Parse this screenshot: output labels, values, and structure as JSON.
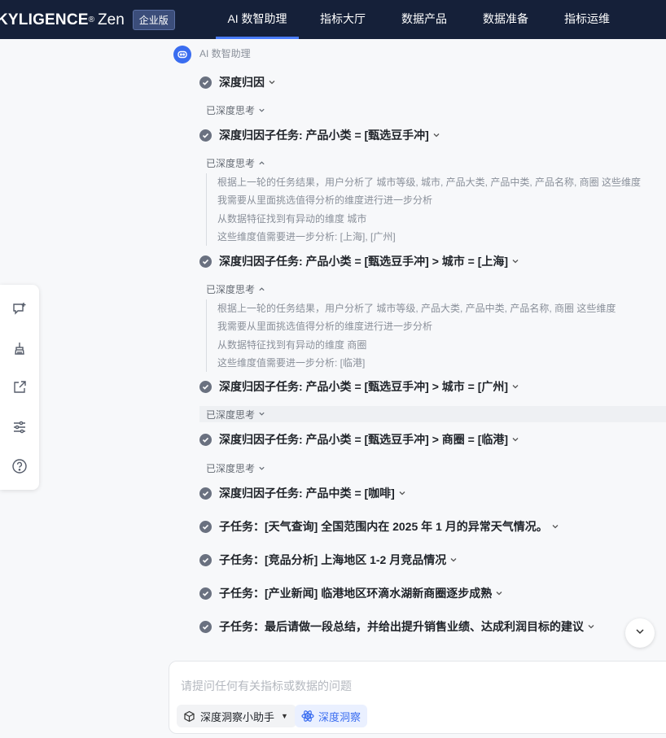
{
  "brand": {
    "name": "KYLIGENCE",
    "registered": "®",
    "product": "Zen",
    "edition_badge": "企业版"
  },
  "nav": {
    "tabs": [
      {
        "label": "AI 数智助理",
        "active": true
      },
      {
        "label": "指标大厅"
      },
      {
        "label": "数据产品"
      },
      {
        "label": "数据准备"
      },
      {
        "label": "指标运维"
      }
    ]
  },
  "sidetools": {
    "icons": [
      "new-chat-icon",
      "clear-broom-icon",
      "share-export-icon",
      "settings-sliders-icon",
      "help-icon"
    ]
  },
  "assistant": {
    "label": "AI 数智助理"
  },
  "steps": {
    "s0": "深度归因",
    "s1": "深度归因子任务: 产品小类 = [甄选豆手冲]",
    "s2": "深度归因子任务: 产品小类 = [甄选豆手冲] > 城市 = [上海]",
    "s3": "深度归因子任务: 产品小类 = [甄选豆手冲] > 城市 = [广州]",
    "s4": "深度归因子任务: 产品小类 = [甄选豆手冲] > 商圈 = [临港]",
    "s5": "深度归因子任务: 产品中类 = [咖啡]",
    "s6": "子任务：[天气查询] 全国范围内在 2025 年 1 月的异常天气情况。",
    "s7": "子任务：[竞品分析] 上海地区 1-2 月竞品情况",
    "s8": "子任务：[产业新闻] 临港地区环滴水湖新商圈逐步成熟",
    "s9": "子任务：最后请做一段总结，并给出提升销售业绩、达成利润目标的建议"
  },
  "thinking": {
    "label": "已深度思考",
    "block1": [
      "根据上一轮的任务结果，用户分析了 城市等级, 城市, 产品大类, 产品中类, 产品名称, 商圈 这些维度",
      "我需要从里面挑选值得分析的维度进行进一步分析",
      "从数据特征找到有异动的维度 城市",
      "这些维度值需要进一步分析: [上海], [广州]"
    ],
    "block2": [
      "根据上一轮的任务结果，用户分析了 城市等级, 产品大类, 产品中类, 产品名称, 商圈 这些维度",
      "我需要从里面挑选值得分析的维度进行进一步分析",
      "从数据特征找到有异动的维度 商圈",
      "这些维度值需要进一步分析: [临港]"
    ]
  },
  "composer": {
    "placeholder": "请提问任何有关指标或数据的问题",
    "agent_label": "深度洞察小助手",
    "insight_label": "深度洞察"
  },
  "colors": {
    "topbar": "#152039",
    "accent": "#3a6df0",
    "active_tab_underline": "#4a7dff"
  }
}
